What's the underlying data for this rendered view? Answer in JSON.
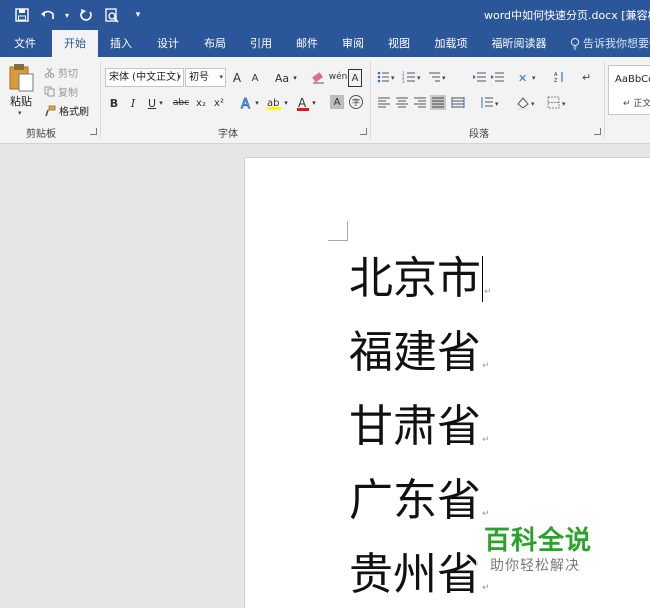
{
  "window": {
    "title": "word中如何快速分页.docx [兼容模"
  },
  "quick_access": {
    "save_icon": "save-icon",
    "undo_icon": "undo-icon",
    "redo_icon": "redo-icon",
    "print_preview_icon": "print-preview-icon",
    "customize_icon": "customize-qat-icon"
  },
  "tabs": [
    {
      "label": "文件"
    },
    {
      "label": "开始"
    },
    {
      "label": "插入"
    },
    {
      "label": "设计"
    },
    {
      "label": "布局"
    },
    {
      "label": "引用"
    },
    {
      "label": "邮件"
    },
    {
      "label": "审阅"
    },
    {
      "label": "视图"
    },
    {
      "label": "加载项"
    },
    {
      "label": "福昕阅读器"
    }
  ],
  "tell_me": {
    "text": "告诉我你想要做"
  },
  "ribbon": {
    "clipboard": {
      "label": "剪贴板",
      "paste": "粘贴",
      "cut": "剪切",
      "copy": "复制",
      "format_painter": "格式刷"
    },
    "font": {
      "label": "字体",
      "font_name": "宋体 (中文正文)",
      "font_size": "初号",
      "grow": "A",
      "shrink": "A",
      "change_case": "Aa",
      "bold": "B",
      "italic": "I",
      "underline": "U",
      "strike": "abc",
      "subscript": "x₂",
      "superscript": "x²",
      "phonetic": "wén",
      "char_border": "A",
      "char_shading": "A",
      "enclose": "字"
    },
    "paragraph": {
      "label": "段落"
    },
    "styles": {
      "sample": "AaBbCcDc",
      "name": "正文"
    }
  },
  "document": {
    "lines": [
      "北京市",
      "福建省",
      "甘肃省",
      "广东省",
      "贵州省"
    ],
    "paragraph_mark": "↵"
  },
  "watermark": {
    "title": "百科全说",
    "subtitle": "助你轻松解决"
  },
  "colors": {
    "title_bar": "#2b579a",
    "ribbon": "#f3f3f3",
    "watermark_green": "#29a329",
    "highlight_yellow": "#ffff00",
    "font_red": "#e81123"
  }
}
